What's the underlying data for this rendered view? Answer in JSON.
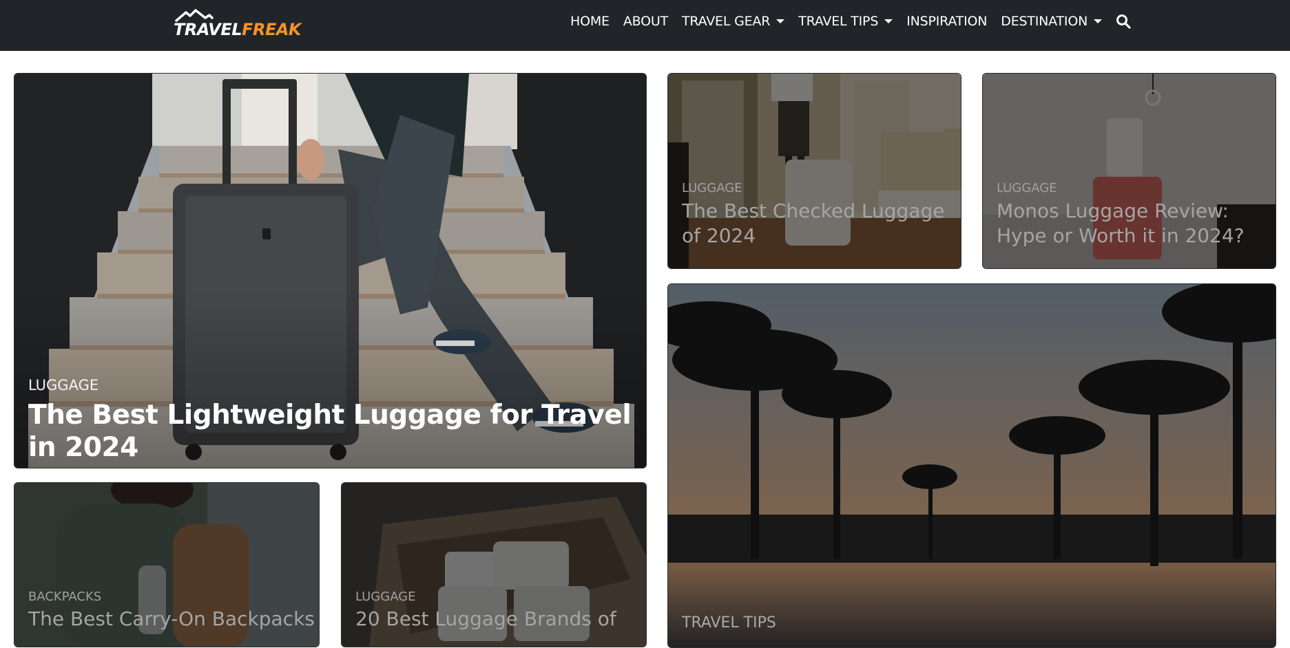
{
  "brand": {
    "logo_travel": "TRAVEL",
    "logo_freak": "FREAK",
    "accent_color": "#f5922b",
    "nav_background": "#212529"
  },
  "nav": {
    "items": [
      {
        "label": "HOME",
        "has_dropdown": false
      },
      {
        "label": "ABOUT",
        "has_dropdown": false
      },
      {
        "label": "TRAVEL GEAR",
        "has_dropdown": true
      },
      {
        "label": "TRAVEL TIPS",
        "has_dropdown": true
      },
      {
        "label": "INSPIRATION",
        "has_dropdown": false
      },
      {
        "label": "DESTINATION",
        "has_dropdown": true
      }
    ],
    "search_icon": "search-icon"
  },
  "posts": {
    "main": {
      "category": "LUGGAGE",
      "title": "The Best Lightweight Luggage for Travel in 2024"
    },
    "checked": {
      "category": "LUGGAGE",
      "title": "The Best Checked Luggage of 2024"
    },
    "monos": {
      "category": "LUGGAGE",
      "title": "Monos Luggage Review: Hype or Worth it in 2024?"
    },
    "palm": {
      "category": "TRAVEL TIPS"
    },
    "backpacks": {
      "category": "BACKPACKS",
      "title": "The Best Carry-On Backpacks"
    },
    "brands": {
      "category": "LUGGAGE",
      "title": "20 Best Luggage Brands of"
    }
  }
}
